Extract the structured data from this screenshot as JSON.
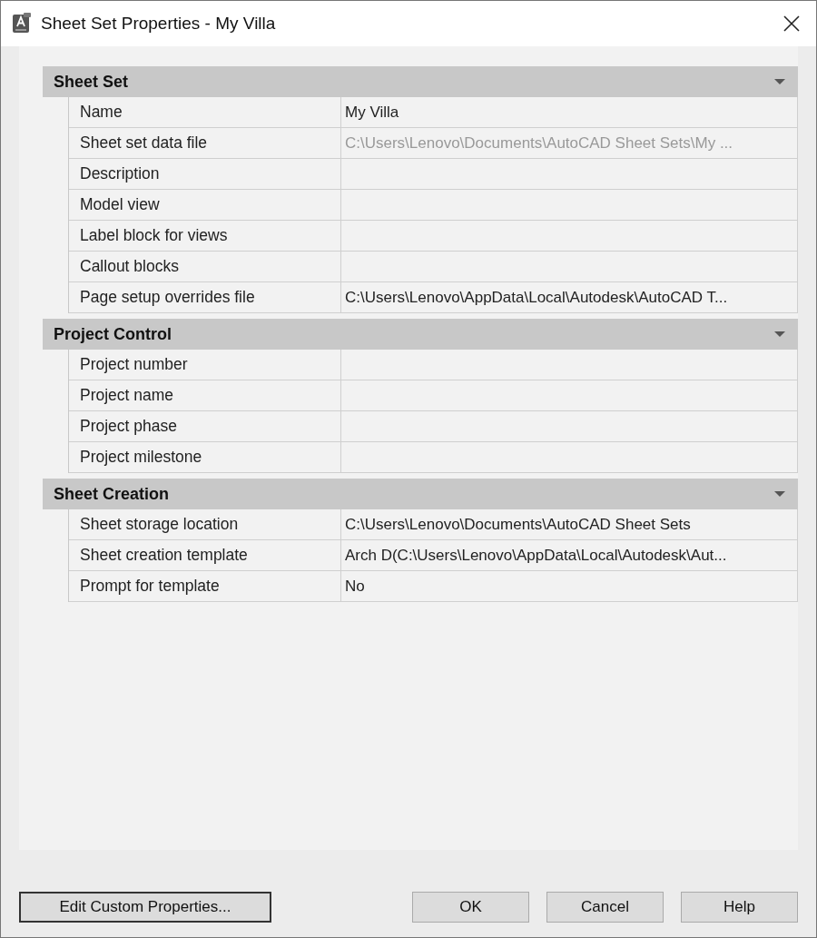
{
  "window": {
    "title": "Sheet Set Properties - My Villa"
  },
  "sections": [
    {
      "title": "Sheet Set",
      "expanded": true,
      "properties": [
        {
          "name": "Name",
          "value": "My Villa",
          "disabled": false
        },
        {
          "name": "Sheet set data file",
          "value": "C:\\Users\\Lenovo\\Documents\\AutoCAD Sheet Sets\\My ...",
          "disabled": true
        },
        {
          "name": "Description",
          "disabled": false
        },
        {
          "name": "Model view",
          "disabled": false
        },
        {
          "name": "Label block for views",
          "disabled": false
        },
        {
          "name": "Callout blocks",
          "disabled": false
        },
        {
          "name": "Page setup overrides file",
          "value": "C:\\Users\\Lenovo\\AppData\\Local\\Autodesk\\AutoCAD T...",
          "disabled": false
        }
      ]
    },
    {
      "title": "Project Control",
      "expanded": true,
      "properties": [
        {
          "name": "Project number",
          "disabled": false
        },
        {
          "name": "Project name",
          "disabled": false
        },
        {
          "name": "Project phase",
          "disabled": false
        },
        {
          "name": "Project milestone",
          "disabled": false
        }
      ]
    },
    {
      "title": "Sheet Creation",
      "expanded": true,
      "properties": [
        {
          "name": "Sheet storage location",
          "value": "C:\\Users\\Lenovo\\Documents\\AutoCAD Sheet Sets",
          "disabled": false
        },
        {
          "name": "Sheet creation template",
          "value": "Arch D(C:\\Users\\Lenovo\\AppData\\Local\\Autodesk\\Aut...",
          "disabled": false
        },
        {
          "name": "Prompt for template",
          "value": "No",
          "disabled": false
        }
      ]
    }
  ],
  "buttons": [
    {
      "label": "Edit Custom Properties...",
      "default": true
    },
    {
      "label": "OK",
      "default": false
    },
    {
      "label": "Cancel",
      "default": false
    },
    {
      "label": "Help",
      "default": false
    }
  ]
}
